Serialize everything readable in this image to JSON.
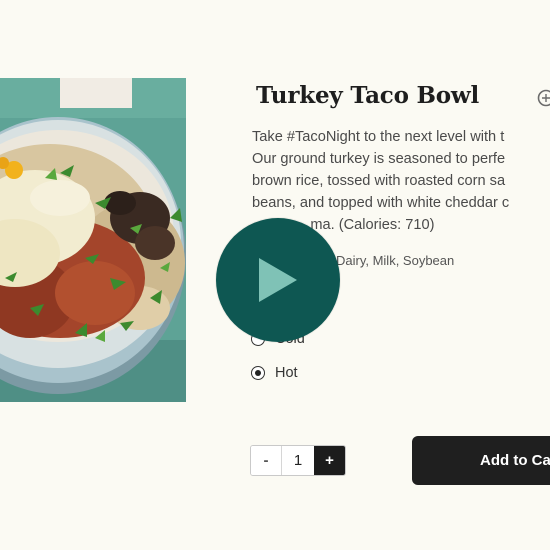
{
  "product": {
    "title": "Turkey Taco Bowl",
    "description_lines": [
      "Take #TacoNight to the next level with t",
      "Our ground turkey is seasoned to perfe",
      "brown rice, tossed with roasted corn sa",
      "beans, and topped with white cheddar c",
      "     ma. (Calories: 710)"
    ],
    "allergens": "Dairy, Milk, Soybean",
    "share_icon": "share-icon"
  },
  "temperature": {
    "options": [
      {
        "label": "Cold",
        "selected": false
      },
      {
        "label": "Hot",
        "selected": true
      }
    ]
  },
  "quantity": {
    "minus_label": "-",
    "value": "1",
    "plus_label": "+"
  },
  "cart": {
    "add_label": "Add to Cart"
  },
  "video": {
    "play_icon": "play-icon"
  },
  "colors": {
    "play_button": "#0e5752",
    "play_triangle": "#7fc2b6",
    "page_background": "#fbfaf3",
    "add_to_cart": "#1f1f1f"
  }
}
